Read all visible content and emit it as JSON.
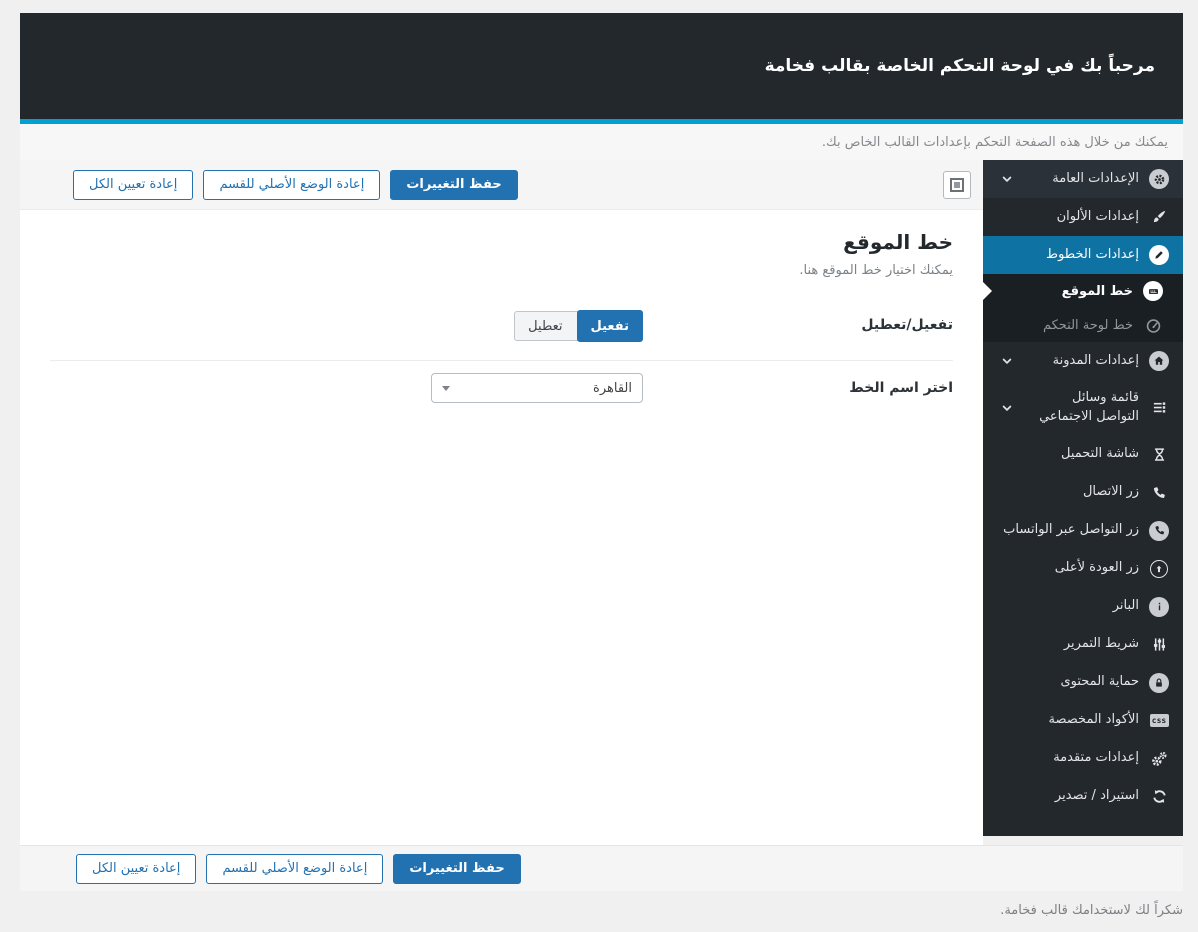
{
  "header": {
    "title": "مرحباً بك في لوحة التحكم الخاصة بقالب فخامة",
    "intro": "يمكنك من خلال هذه الصفحة التحكم بإعدادات القالب الخاص بك."
  },
  "action_bar": {
    "save_label": "حفظ التغييرات",
    "reset_section_label": "إعادة الوضع الأصلي للقسم",
    "reset_all_label": "إعادة تعيين الكل",
    "expand_icon": "expand-options-icon"
  },
  "section": {
    "title": "خط الموقع",
    "description": "يمكنك اختيار خط الموقع هنا.",
    "fields": [
      {
        "label": "تفعيل/تعطيل",
        "type": "toggle",
        "on_label": "تفعيل",
        "off_label": "تعطيل",
        "value": "تفعيل"
      },
      {
        "label": "اختر اسم الخط",
        "type": "select",
        "value": "القاهرة"
      }
    ]
  },
  "sidebar": {
    "items": [
      {
        "label": "الإعدادات العامة",
        "icon": "gear-icon",
        "expandable": true
      },
      {
        "label": "إعدادات الألوان",
        "icon": "brush-icon"
      },
      {
        "label": "إعدادات الخطوط",
        "icon": "pencil-circle-icon",
        "active": true
      },
      {
        "label": "خط الموقع",
        "icon": "keyboard-circle-icon",
        "sub": true,
        "current": true
      },
      {
        "label": "خط لوحة التحكم",
        "icon": "dashboard-icon",
        "sub": true
      },
      {
        "label": "إعدادات المدونة",
        "icon": "home-circle-icon",
        "expandable": true
      },
      {
        "label": "قائمة وسائل التواصل الاجتماعي",
        "icon": "list-icon",
        "expandable": true
      },
      {
        "label": "شاشة التحميل",
        "icon": "hourglass-icon"
      },
      {
        "label": "زر الاتصال",
        "icon": "phone-icon"
      },
      {
        "label": "زر التواصل عبر الواتساب",
        "icon": "phone-circle-icon"
      },
      {
        "label": "زر العودة لأعلى",
        "icon": "arrow-up-circle-icon"
      },
      {
        "label": "البانر",
        "icon": "info-circle-icon"
      },
      {
        "label": "شريط التمرير",
        "icon": "sliders-icon"
      },
      {
        "label": "حماية المحتوى",
        "icon": "lock-circle-icon"
      },
      {
        "label": "الأكواد المخصصة",
        "icon": "css-badge-icon"
      },
      {
        "label": "إعدادات متقدمة",
        "icon": "gears-icon"
      },
      {
        "label": "استيراد / تصدير",
        "icon": "sync-icon"
      }
    ]
  },
  "footer": {
    "thanks": "شكراً لك لاستخدامك قالب فخامة."
  },
  "colors": {
    "header_bg": "#23282d",
    "accent_line": "#00a0d2",
    "primary_button": "#2271b1",
    "sidebar_active": "#0e73a2"
  }
}
